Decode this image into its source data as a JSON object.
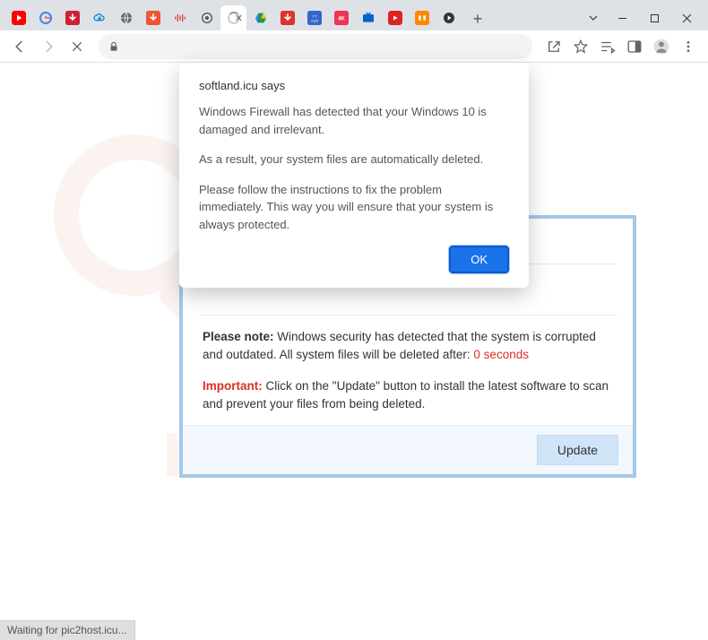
{
  "alert": {
    "title": "softland.icu says",
    "p1": "Windows Firewall has detected that your Windows 10 is damaged and irrelevant.",
    "p2": "As a result, your system files are automatically deleted.",
    "p3": "Please follow the instructions to fix the problem immediately. This way you will ensure that your system is always protected.",
    "ok": "OK"
  },
  "scam": {
    "note_label": "Please note:",
    "note_text": " Windows security has detected that the system is corrupted and outdated. All system files will be deleted after: ",
    "countdown": "0 seconds",
    "important_label": "Important:",
    "important_text": " Click on the \"Update\" button to install the latest software to scan and prevent your files from being deleted.",
    "update_btn": "Update"
  },
  "status": "Waiting for pic2host.icu...",
  "watermark_text": "risk.com"
}
